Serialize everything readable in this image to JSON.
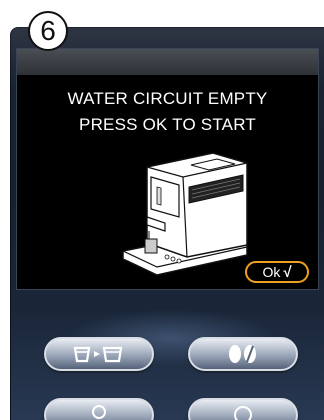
{
  "step": {
    "number": "6"
  },
  "screen": {
    "message_line1": "WATER CIRCUIT EMPTY",
    "message_line2": "PRESS OK TO START",
    "ok_label": "Ok",
    "ok_check": "√"
  },
  "controls": {
    "buttons": [
      {
        "icon": "cup-transfer-icon"
      },
      {
        "icon": "coffee-beans-icon"
      },
      {
        "icon": "steam-icon"
      },
      {
        "icon": "power-icon"
      }
    ]
  },
  "colors": {
    "accent_orange": "#f0a020",
    "screen_bg": "#000000",
    "panel_bg": "#1c2433"
  }
}
